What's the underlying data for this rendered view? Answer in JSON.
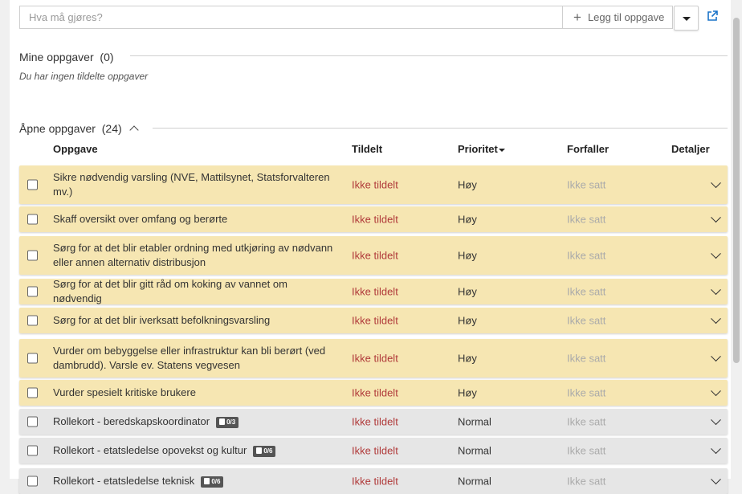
{
  "task_input": {
    "placeholder": "Hva må gjøres?"
  },
  "add_button": {
    "label": "Legg til oppgave"
  },
  "my_tasks": {
    "title": "Mine oppgaver",
    "count": "(0)",
    "empty_text": "Du har ingen tildelte oppgaver"
  },
  "open_tasks": {
    "title": "Åpne oppgaver",
    "count": "(24)",
    "columns": {
      "task": "Oppgave",
      "assigned": "Tildelt",
      "priority": "Prioritet",
      "due": "Forfaller",
      "details": "Detaljer"
    },
    "rows": [
      {
        "task": "Sikre nødvendig varsling (NVE, Mattilsynet, Statsforvalteren mv.)",
        "assigned": "Ikke tildelt",
        "priority": "Høy",
        "due": "Ikke satt",
        "badge": ""
      },
      {
        "task": "Skaff oversikt over omfang og berørte",
        "assigned": "Ikke tildelt",
        "priority": "Høy",
        "due": "Ikke satt",
        "badge": ""
      },
      {
        "task": "Sørg for at det blir etabler ordning med utkjøring av nødvann eller annen alternativ distribusjon",
        "assigned": "Ikke tildelt",
        "priority": "Høy",
        "due": "Ikke satt",
        "badge": ""
      },
      {
        "task": "Sørg for at det blir gitt råd om koking av vannet om nødvendig",
        "assigned": "Ikke tildelt",
        "priority": "Høy",
        "due": "Ikke satt",
        "badge": ""
      },
      {
        "task": "Sørg for at det blir iverksatt befolkningsvarsling",
        "assigned": "Ikke tildelt",
        "priority": "Høy",
        "due": "Ikke satt",
        "badge": ""
      },
      {
        "task": "Vurder om bebyggelse eller infrastruktur kan bli berørt (ved dambrudd). Varsle ev. Statens vegvesen",
        "assigned": "Ikke tildelt",
        "priority": "Høy",
        "due": "Ikke satt",
        "badge": ""
      },
      {
        "task": "Vurder spesielt kritiske brukere",
        "assigned": "Ikke tildelt",
        "priority": "Høy",
        "due": "Ikke satt",
        "badge": ""
      },
      {
        "task": "Rollekort - beredskapskoordinator",
        "assigned": "Ikke tildelt",
        "priority": "Normal",
        "due": "Ikke satt",
        "badge": "0/3"
      },
      {
        "task": "Rollekort - etatsledelse opovekst og kultur",
        "assigned": "Ikke tildelt",
        "priority": "Normal",
        "due": "Ikke satt",
        "badge": "0/6"
      },
      {
        "task": "Rollekort - etatsledelse teknisk",
        "assigned": "Ikke tildelt",
        "priority": "Normal",
        "due": "Ikke satt",
        "badge": "0/6"
      }
    ]
  },
  "colors": {
    "high_row": "#f6e6b2",
    "normal_row": "#e6e6e6",
    "assigned_text": "#b03a3a",
    "due_text": "#aaaaaa"
  },
  "icons": {
    "add": "plus-icon",
    "dropdown": "caret-down-icon",
    "external": "external-link-icon",
    "collapse": "chevron-up-icon",
    "expand": "chevron-down-icon",
    "sort": "sort-desc-icon",
    "badge": "clipboard-icon"
  }
}
